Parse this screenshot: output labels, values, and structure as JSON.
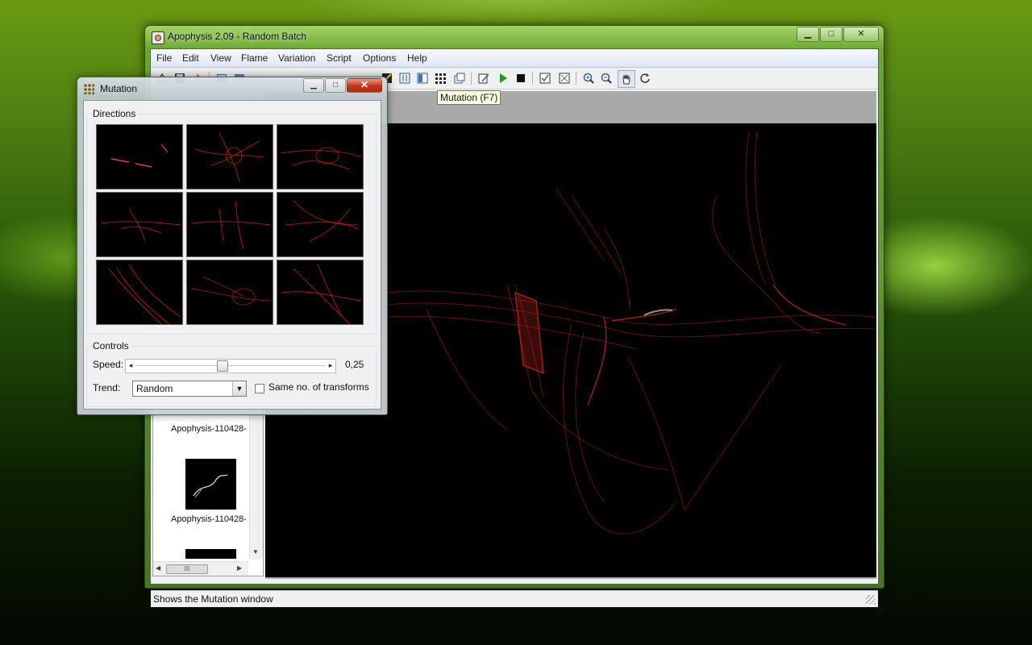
{
  "main_window": {
    "title": "Apophysis 2.09 - Random Batch",
    "caption_buttons": {
      "minimize": "▁",
      "maximize": "□",
      "close": "✕"
    }
  },
  "menu": [
    "File",
    "Edit",
    "View",
    "Flame",
    "Variation",
    "Script",
    "Options",
    "Help"
  ],
  "toolbar": {
    "icons": [
      "open-icon",
      "save-icon",
      "fire-icon",
      "list-icon",
      "image-icon",
      "undo-icon",
      "redo-icon",
      "mirror-icon",
      "window-icon",
      "triangles-icon",
      "adjust-icon",
      "gradient-icon",
      "mutation-icon",
      "copy-icon",
      "edit-script-icon",
      "play-icon",
      "stop-icon",
      "options-icon",
      "fit-icon",
      "zoom-in-icon",
      "zoom-out-icon",
      "hand-icon",
      "rotate-icon"
    ],
    "tooltip": "Mutation (F7)"
  },
  "thumbnails": [
    {
      "caption": "Apophysis-110428-"
    },
    {
      "caption": "Apophysis-110428-"
    }
  ],
  "scrollbar_thumb_label": "III",
  "status": "Shows the Mutation window",
  "mutation_window": {
    "title": "Mutation",
    "directions_label": "Directions",
    "controls_label": "Controls",
    "speed_label": "Speed:",
    "speed_value": "0,25",
    "speed_level": 0.45,
    "trend_label": "Trend:",
    "trend_value": "Random",
    "same_transforms_label": "Same no. of transforms",
    "same_transforms_checked": false
  },
  "colors": {
    "flame_red": "#c0201c",
    "tooltip_bg": "#ffffe1",
    "close_button": "#c2361c"
  }
}
